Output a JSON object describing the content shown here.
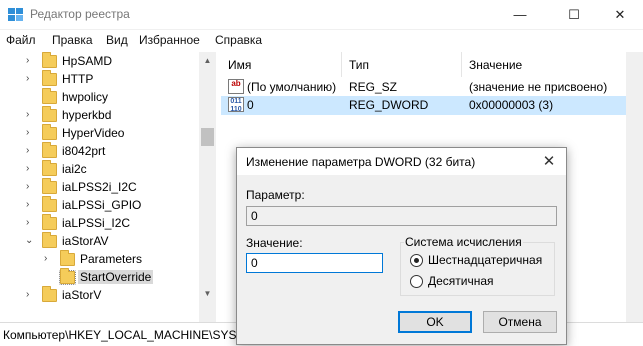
{
  "window": {
    "title": "Редактор реестра",
    "controls": {
      "minimize": "—",
      "maximize": "☐",
      "close": "✕"
    }
  },
  "menu": [
    "Файл",
    "Правка",
    "Вид",
    "Избранное",
    "Справка"
  ],
  "tree": {
    "items": [
      {
        "label": "HpSAMD",
        "expander": "›"
      },
      {
        "label": "HTTP",
        "expander": "›"
      },
      {
        "label": "hwpolicy",
        "expander": ""
      },
      {
        "label": "hyperkbd",
        "expander": "›"
      },
      {
        "label": "HyperVideo",
        "expander": "›"
      },
      {
        "label": "i8042prt",
        "expander": "›"
      },
      {
        "label": "iai2c",
        "expander": "›"
      },
      {
        "label": "iaLPSS2i_I2C",
        "expander": "›"
      },
      {
        "label": "iaLPSSi_GPIO",
        "expander": "›"
      },
      {
        "label": "iaLPSSi_I2C",
        "expander": "›"
      },
      {
        "label": "iaStorAV",
        "expander": "⌄"
      },
      {
        "label": "Parameters",
        "expander": "›"
      },
      {
        "label": "StartOverride",
        "expander": ""
      },
      {
        "label": "iaStorV",
        "expander": "›"
      }
    ]
  },
  "list": {
    "columns": {
      "name": "Имя",
      "type": "Тип",
      "value": "Значение"
    },
    "rows": [
      {
        "icon": "ab",
        "name": "(По умолчанию)",
        "type": "REG_SZ",
        "value": "(значение не присвоено)"
      },
      {
        "icon": "011\n110",
        "name": "0",
        "type": "REG_DWORD",
        "value": "0x00000003 (3)"
      }
    ]
  },
  "status": {
    "path": "Компьютер\\HKEY_LOCAL_MACHINE\\SYSTEM\\CurrentControlSet\\Services\\iaStorAV\\StartOverride"
  },
  "dialog": {
    "title": "Изменение параметра DWORD (32 бита)",
    "close": "✕",
    "param_label": "Параметр:",
    "param_value": "0",
    "value_label": "Значение:",
    "value_value": "0",
    "base_group": "Система исчисления",
    "base_options": [
      "Шестнадцатеричная",
      "Десятичная"
    ],
    "base_selected": "Шестнадцатеричная",
    "ok": "OK",
    "cancel": "Отмена"
  },
  "colors": {
    "selection": "#cce8ff",
    "folder": "#f5cc5a",
    "accent": "#0078d7"
  }
}
